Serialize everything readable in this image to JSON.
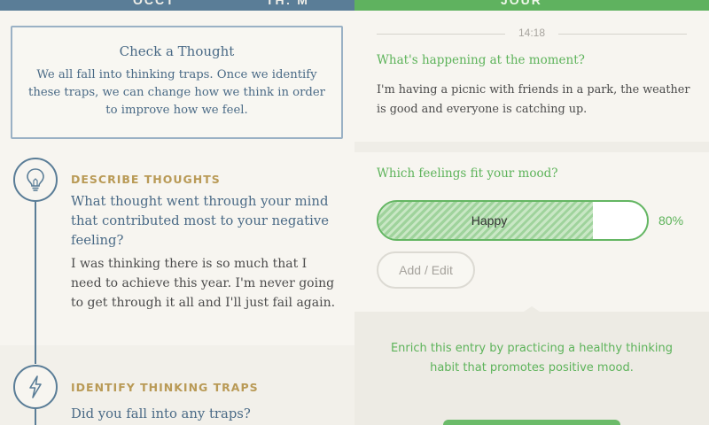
{
  "left": {
    "header_left": "OCCT",
    "header_right": "TH: M",
    "card": {
      "title": "Check a Thought",
      "body": "We all fall into thinking traps. Once we identify these traps, we can change how we think in order to improve how we feel."
    },
    "steps": [
      {
        "label": "DESCRIBE THOUGHTS",
        "icon": "lightbulb-icon",
        "question": "What thought went through your mind that contributed most to your negative feeling?",
        "answer": "I was thinking there is so much that I need to achieve this year. I'm never going to get through it all and I'll just fail again."
      },
      {
        "label": "IDENTIFY THINKING TRAPS",
        "icon": "lightning-icon",
        "question": "Did you fall into any traps?"
      }
    ]
  },
  "right": {
    "header_center": "JOUR",
    "time": "14:18",
    "happening": {
      "question": "What's happening at the moment?",
      "answer": "I'm having a picnic with friends in a park, the weather is good and everyone is catching up."
    },
    "feelings": {
      "question": "Which feelings fit your mood?",
      "mood": {
        "label": "Happy",
        "percent": 80,
        "percent_text": "80%"
      },
      "add_label": "Add / Edit"
    },
    "enrich_text": "Enrich this entry by practicing a healthy thinking habit that promotes positive mood."
  },
  "colors": {
    "blue_header": "#5a7d97",
    "green_header": "#5fb25f",
    "gold_label": "#b99a56",
    "green_text": "#5db35a"
  }
}
